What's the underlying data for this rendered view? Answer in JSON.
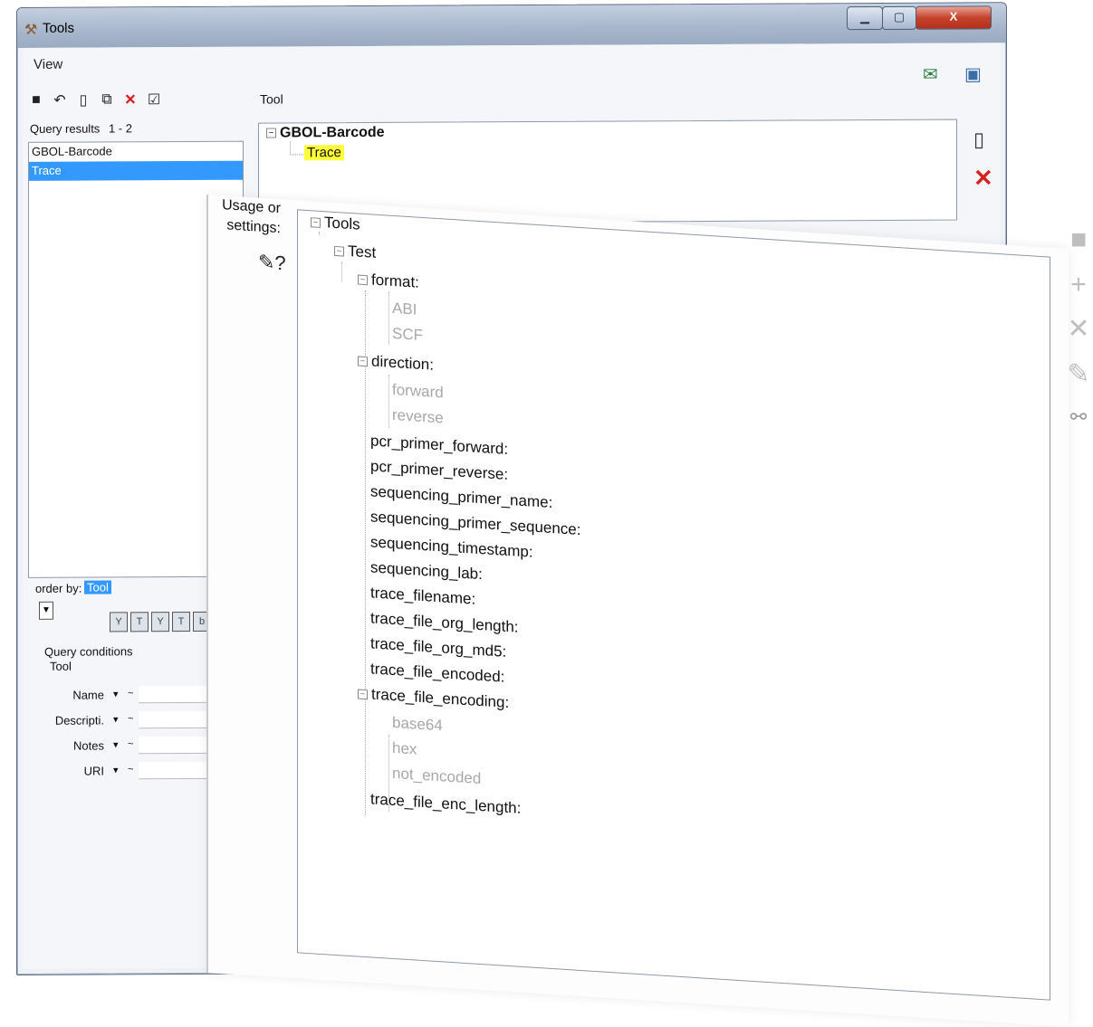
{
  "window": {
    "title": "Tools",
    "title_icon": "tools-icon"
  },
  "menu": {
    "view": "View"
  },
  "toolbar": {
    "icons": [
      "save-icon",
      "undo-icon",
      "new-document-icon",
      "copy-icon",
      "delete-icon",
      "check-icon"
    ],
    "delete_glyph": "✕",
    "check_glyph": "☑"
  },
  "query": {
    "label": "Query results",
    "range": "1 - 2",
    "items": [
      "GBOL-Barcode",
      "Trace"
    ],
    "selected": "Trace",
    "order_by_label": "order by:",
    "order_by_value": "Tool",
    "conditions_label": "Query conditions",
    "conditions_entity": "Tool",
    "condition_op": "▾",
    "condition_tilde": "~",
    "conditions": [
      "Name",
      "Descripti.",
      "Notes",
      "URI"
    ]
  },
  "tool": {
    "label": "Tool",
    "tree_root": "GBOL-Barcode",
    "tree_child": "Trace"
  },
  "usage": {
    "label_line1": "Usage or",
    "label_line2": "settings:",
    "tree": {
      "root": "Tools",
      "test": "Test",
      "format": "format:",
      "format_options": [
        "ABI",
        "SCF"
      ],
      "direction": "direction:",
      "direction_options": [
        "forward",
        "reverse"
      ],
      "fields_a": [
        "pcr_primer_forward:",
        "pcr_primer_reverse:",
        "sequencing_primer_name:",
        "sequencing_primer_sequence:",
        "sequencing_timestamp:",
        "sequencing_lab:",
        "trace_filename:",
        "trace_file_org_length:",
        "trace_file_org_md5:",
        "trace_file_encoded:"
      ],
      "encoding": "trace_file_encoding:",
      "encoding_options": [
        "base64",
        "hex",
        "not_encoded"
      ],
      "enc_length": "trace_file_enc_length:"
    }
  },
  "accent": {
    "selection": "#3399ff",
    "highlight": "#ffff2e",
    "delete": "#d81e1e"
  }
}
